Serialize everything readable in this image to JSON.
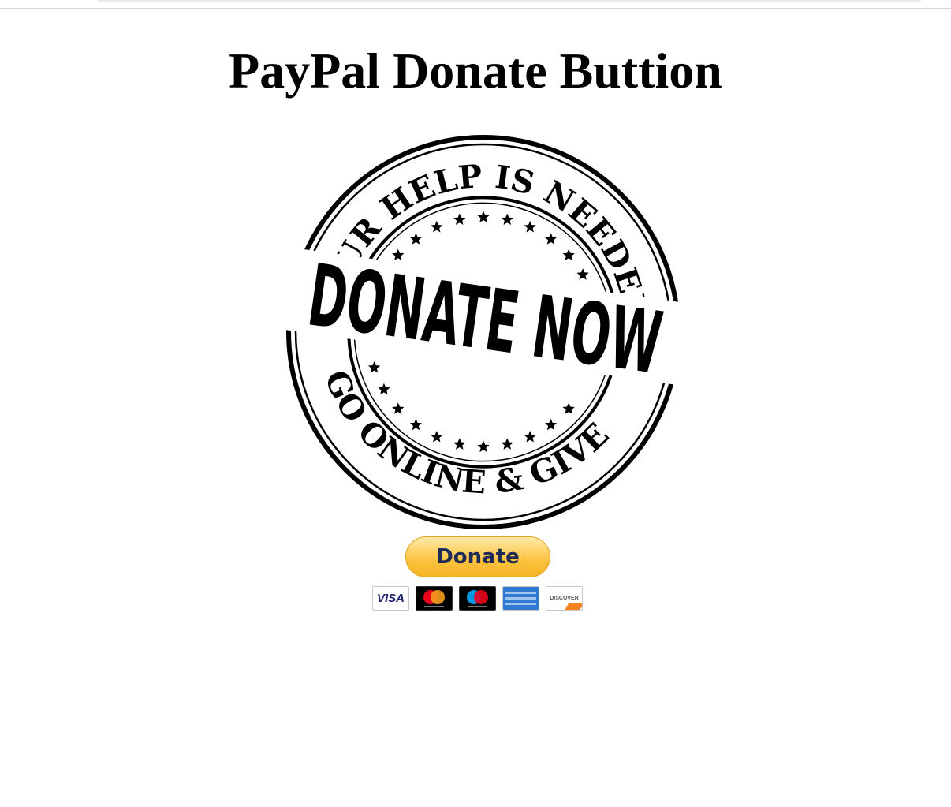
{
  "page": {
    "title": "PayPal Donate Buttion"
  },
  "stamp": {
    "top_text": "YOUR HELP IS NEEDED",
    "center_text": "DONATE NOW",
    "bottom_text": "GO ONLINE & GIVE"
  },
  "donate": {
    "button_label": "Donate"
  },
  "payment_cards": [
    {
      "name": "visa",
      "label": "VISA"
    },
    {
      "name": "mastercard",
      "label": ""
    },
    {
      "name": "maestro",
      "label": ""
    },
    {
      "name": "american-express",
      "label": ""
    },
    {
      "name": "discover",
      "label": "DISCOVER"
    }
  ],
  "colors": {
    "donate_button": "#fbc23d",
    "donate_text": "#1e2b57",
    "mastercard_red": "#eb001b",
    "mastercard_orange": "#f79e1b",
    "maestro_blue": "#0099df",
    "amex_blue": "#2f79d1",
    "discover_orange": "#f58220"
  }
}
